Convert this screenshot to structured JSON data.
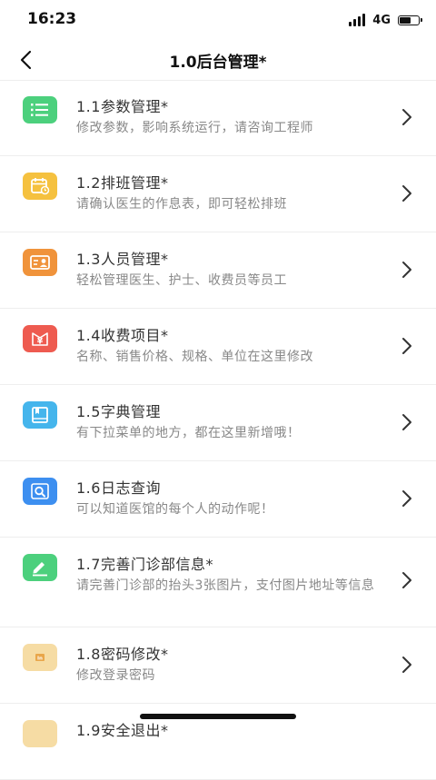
{
  "status_bar": {
    "time": "16:23",
    "network": "4G",
    "battery_level": 0.55
  },
  "nav": {
    "title": "1.0后台管理*"
  },
  "menu": [
    {
      "title": "1.1参数管理*",
      "desc": "修改参数，影响系统运行，请咨询工程师",
      "icon": "list-icon",
      "color": "#4cd07d"
    },
    {
      "title": "1.2排班管理*",
      "desc": "请确认医生的作息表，即可轻松排班",
      "icon": "calendar-icon",
      "color": "#f5c13f"
    },
    {
      "title": "1.3人员管理*",
      "desc": "轻松管理医生、护士、收费员等员工",
      "icon": "id-card-icon",
      "color": "#f0933b"
    },
    {
      "title": "1.4收费项目*",
      "desc": "名称、销售价格、规格、单位在这里修改",
      "icon": "yen-icon",
      "color": "#ee5b50"
    },
    {
      "title": "1.5字典管理",
      "desc": "有下拉菜单的地方，都在这里新增哦！",
      "icon": "book-icon",
      "color": "#45b5ec"
    },
    {
      "title": "1.6日志查询",
      "desc": "可以知道医馆的每个人的动作呢！",
      "icon": "search-icon",
      "color": "#3d8ff0"
    },
    {
      "title": "1.7完善门诊部信息*",
      "desc": "请完善门诊部的抬头3张图片，支付图片地址等信息",
      "icon": "edit-icon",
      "color": "#4cd07d"
    },
    {
      "title": "1.8密码修改*",
      "desc": "修改登录密码",
      "icon": "password-icon",
      "color": "#f6dca4"
    },
    {
      "title": "1.9安全退出*",
      "desc": "",
      "icon": "exit-icon",
      "color": "#f6dca4"
    }
  ]
}
